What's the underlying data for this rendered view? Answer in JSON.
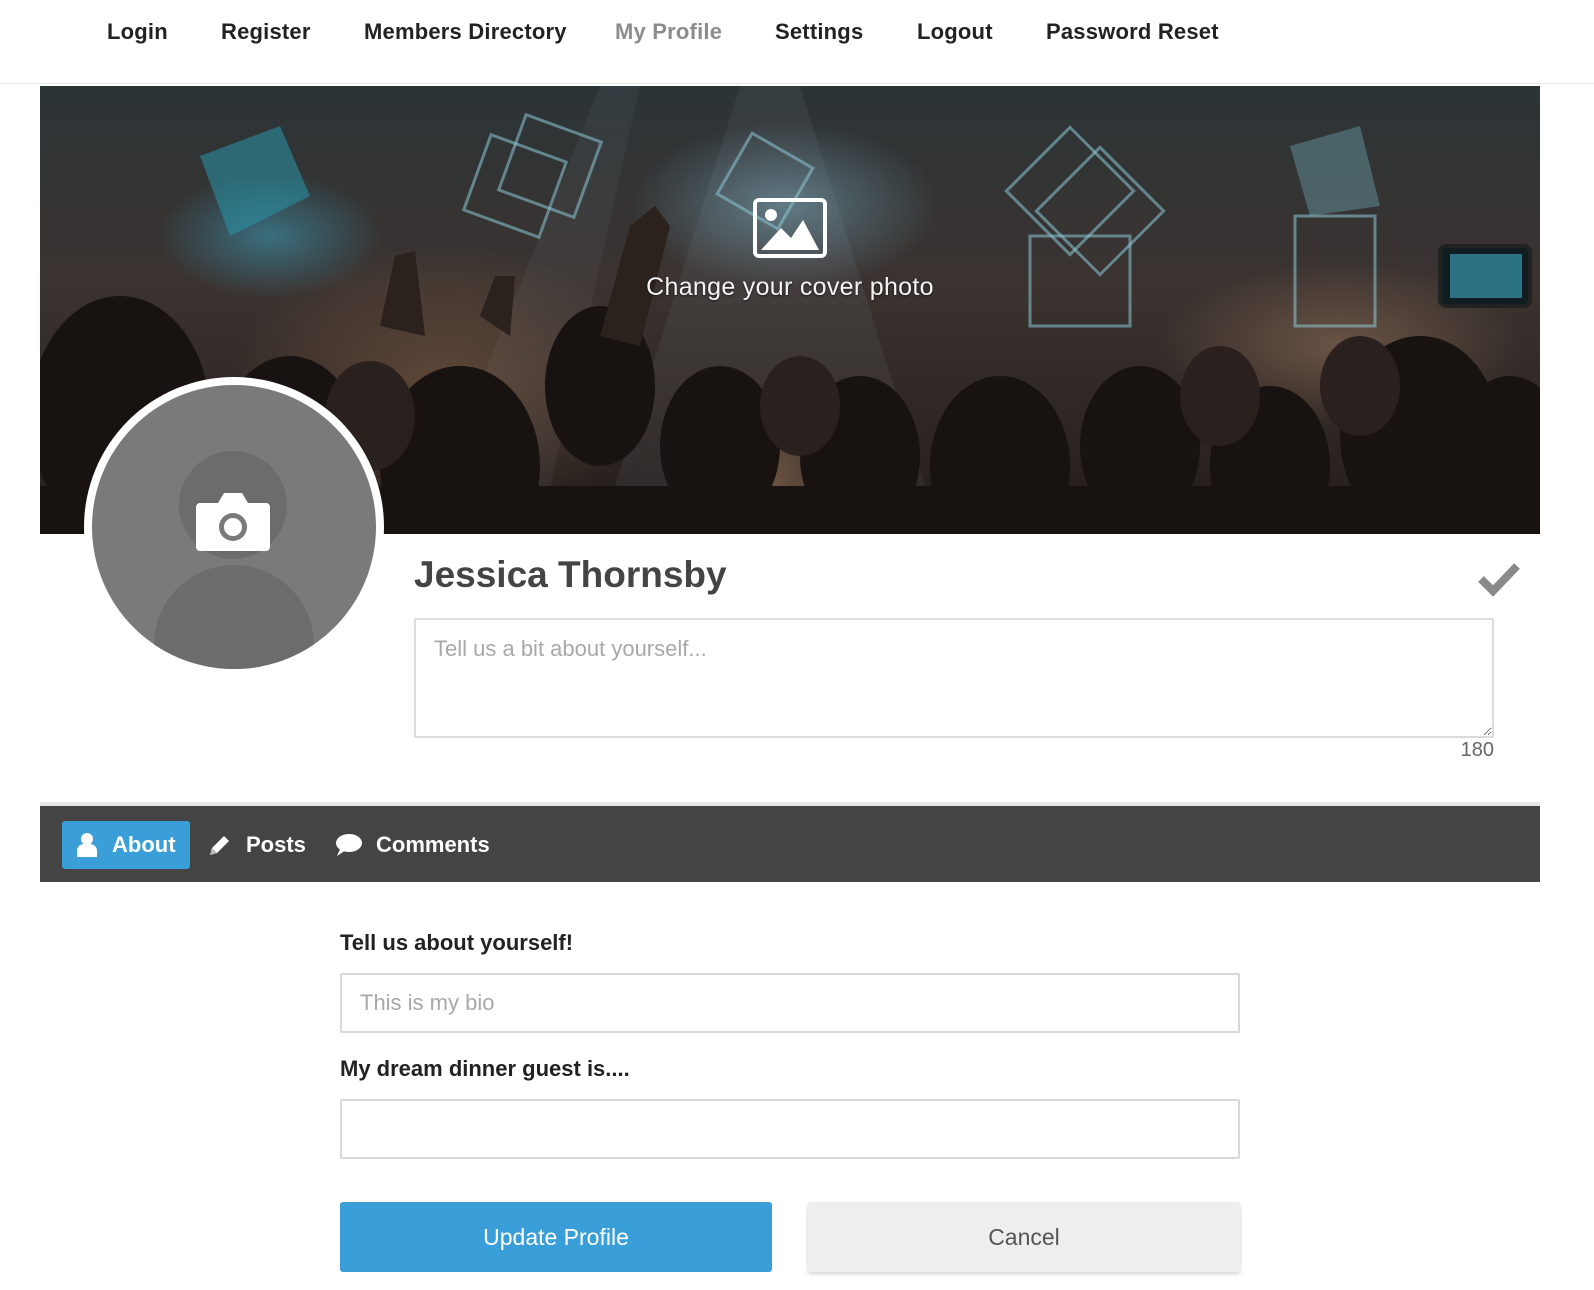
{
  "nav": {
    "items": [
      {
        "label": "Login",
        "active": false
      },
      {
        "label": "Register",
        "active": false
      },
      {
        "label": "Members Directory",
        "active": false
      },
      {
        "label": "My Profile",
        "active": true
      },
      {
        "label": "Settings",
        "active": false
      },
      {
        "label": "Logout",
        "active": false
      },
      {
        "label": "Password Reset",
        "active": false
      }
    ]
  },
  "cover": {
    "cta_text": "Change your cover photo",
    "icon": "image-icon"
  },
  "avatar": {
    "icon": "camera-icon"
  },
  "profile": {
    "name": "Jessica Thornsby",
    "bio_placeholder": "Tell us a bit about yourself...",
    "bio_value": "",
    "char_count": "180",
    "save_icon": "checkmark-icon"
  },
  "tabs": [
    {
      "label": "About",
      "icon": "user-icon",
      "active": true
    },
    {
      "label": "Posts",
      "icon": "pencil-icon",
      "active": false
    },
    {
      "label": "Comments",
      "icon": "speech-bubble-icon",
      "active": false
    }
  ],
  "form": {
    "fields": [
      {
        "label": "Tell us about yourself!",
        "placeholder": "This is my bio",
        "value": ""
      },
      {
        "label": "My dream dinner guest is....",
        "placeholder": "",
        "value": ""
      }
    ],
    "update_label": "Update Profile",
    "cancel_label": "Cancel"
  },
  "colors": {
    "accent": "#3a9fd8",
    "tabbar": "#444444",
    "nav_active": "#8c8c8c"
  }
}
